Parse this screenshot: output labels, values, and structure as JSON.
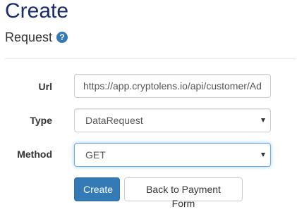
{
  "header": {
    "title": "Create",
    "subtitle": "Request",
    "help_icon_glyph": "?"
  },
  "form": {
    "url": {
      "label": "Url",
      "value": "https://app.cryptolens.io/api/customer/AddCustomer"
    },
    "type": {
      "label": "Type",
      "selected": "DataRequest"
    },
    "method": {
      "label": "Method",
      "selected": "GET"
    }
  },
  "actions": {
    "create_label": "Create",
    "back_label": "Back to Payment Form"
  },
  "colors": {
    "title": "#1a2b6d",
    "primary": "#337ab7",
    "focus_border": "#66afe9"
  }
}
